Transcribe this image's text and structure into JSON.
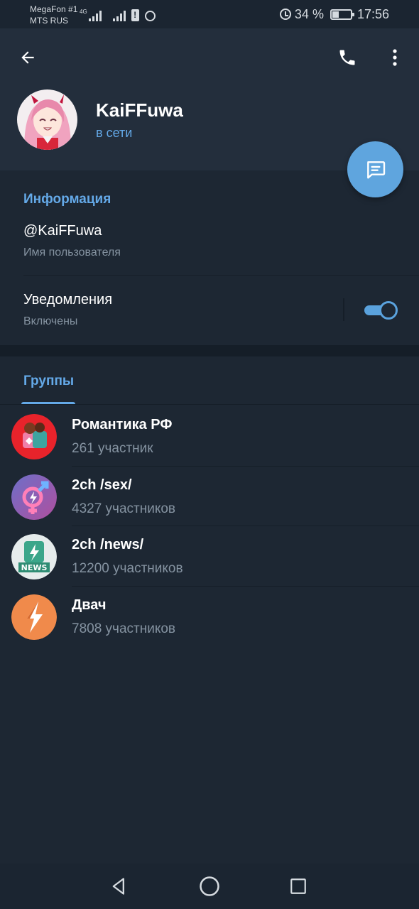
{
  "status_bar": {
    "carrier_1": "MegaFon #1",
    "carrier_2": "MTS RUS",
    "network_tag": "4G",
    "battery_percent": "34 %",
    "battery_level": 0.34,
    "time": "17:56"
  },
  "header": {
    "icons": {
      "back": "arrow-left-icon",
      "call": "phone-icon",
      "menu": "more-vertical-icon",
      "fab": "message-icon"
    }
  },
  "profile": {
    "name": "KaiFFuwa",
    "status": "в сети"
  },
  "info": {
    "title": "Информация",
    "username": "@KaiFFuwa",
    "username_label": "Имя пользователя",
    "notifications_label": "Уведомления",
    "notifications_state": "Включены",
    "notifications_on": true
  },
  "groups_tab": {
    "label": "Группы"
  },
  "groups": [
    {
      "name": "Романтика РФ",
      "count": "261 участник",
      "icon": "romance-avatar",
      "color": "#e8232b"
    },
    {
      "name": "2ch /sex/",
      "count": "4327 участников",
      "icon": "gender-avatar",
      "color": "#8a5fb8"
    },
    {
      "name": "2ch /news/",
      "count": "12200 участников",
      "icon": "news-avatar",
      "color": "#e6ecec"
    },
    {
      "name": "Двач",
      "count": "7808 участников",
      "icon": "lightning-avatar",
      "color": "#f08a4b"
    }
  ],
  "colors": {
    "accent": "#64a9e8",
    "header_bg": "#232e3c",
    "page_bg": "#1d2733",
    "fab": "#5fa5de",
    "secondary_text": "#8593a1"
  }
}
